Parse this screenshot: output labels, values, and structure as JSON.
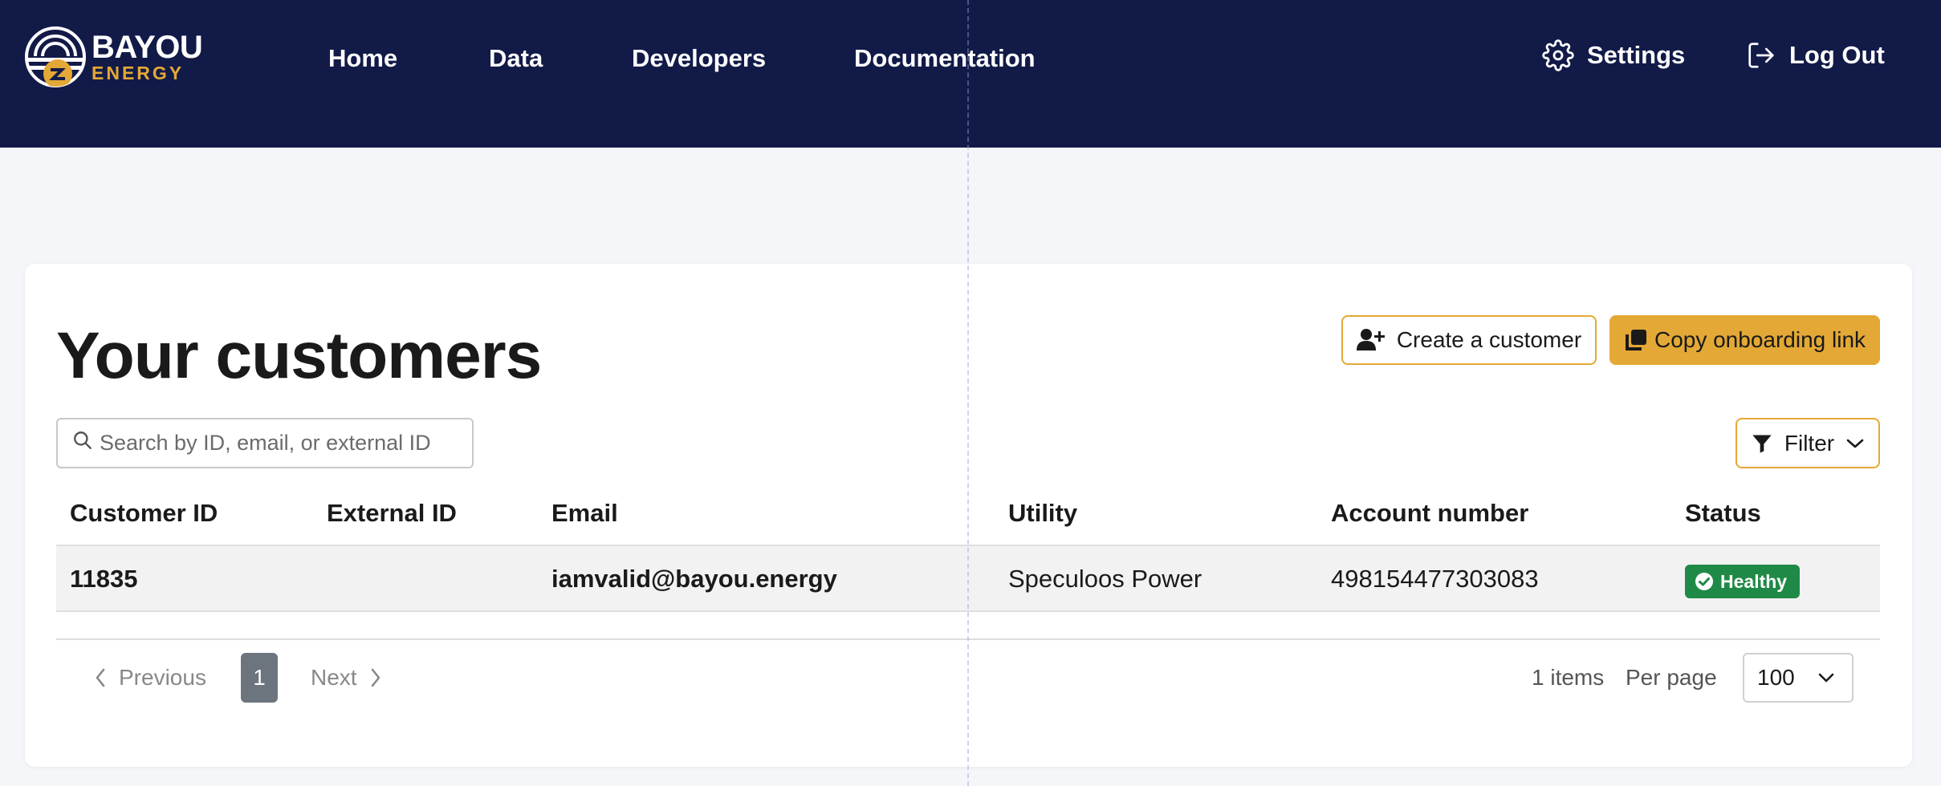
{
  "brand": {
    "name_line1": "BAYOU",
    "name_line2": "ENERGY"
  },
  "nav": {
    "items": [
      {
        "label": "Home"
      },
      {
        "label": "Data"
      },
      {
        "label": "Developers"
      },
      {
        "label": "Documentation"
      }
    ],
    "settings_label": "Settings",
    "logout_label": "Log Out"
  },
  "page": {
    "title": "Your customers",
    "create_button": "Create a customer",
    "copy_button": "Copy onboarding link",
    "search_placeholder": "Search by ID, email, or external ID",
    "filter_button": "Filter"
  },
  "table": {
    "columns": [
      "Customer ID",
      "External ID",
      "Email",
      "Utility",
      "Account number",
      "Status"
    ],
    "rows": [
      {
        "customer_id": "11835",
        "external_id": "",
        "email": "iamvalid@bayou.energy",
        "utility": "Speculoos Power",
        "account_number": "498154477303083",
        "status": "Healthy"
      }
    ]
  },
  "pagination": {
    "previous": "Previous",
    "current_page": "1",
    "next": "Next",
    "items_count": "1 items",
    "per_page_label": "Per page",
    "per_page_value": "100"
  },
  "colors": {
    "header_bg": "#121a48",
    "accent_gold": "#e3a835",
    "status_green": "#1f8a47"
  }
}
